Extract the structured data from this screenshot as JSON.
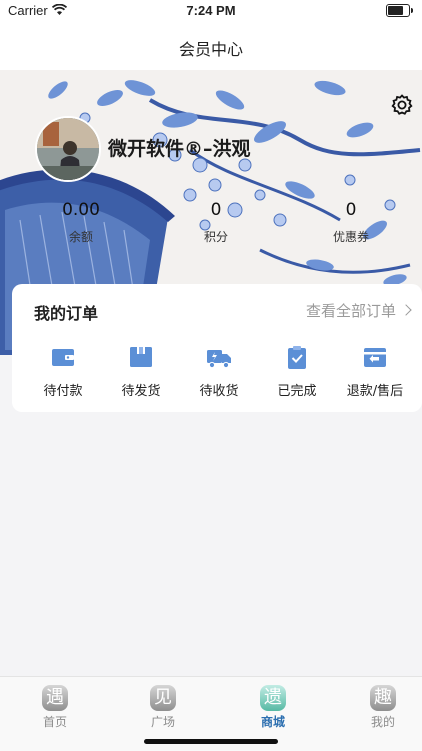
{
  "status_bar": {
    "carrier": "Carrier",
    "time": "7:24 PM"
  },
  "nav": {
    "title": "会员中心"
  },
  "profile": {
    "username": "微开软件®–洪观",
    "stats": [
      {
        "value": "0.00",
        "label": "余额"
      },
      {
        "value": "0",
        "label": "积分"
      },
      {
        "value": "0",
        "label": "优惠券"
      }
    ]
  },
  "orders": {
    "title": "我的订单",
    "view_all": "查看全部订单",
    "items": [
      {
        "label": "待付款",
        "icon": "wallet-icon"
      },
      {
        "label": "待发货",
        "icon": "box-icon"
      },
      {
        "label": "待收货",
        "icon": "truck-icon"
      },
      {
        "label": "已完成",
        "icon": "clipboard-check-icon"
      },
      {
        "label": "退款/售后",
        "icon": "refund-icon"
      }
    ]
  },
  "tabbar": {
    "items": [
      {
        "glyph": "遇",
        "label": "首页"
      },
      {
        "glyph": "见",
        "label": "广场"
      },
      {
        "glyph": "遗",
        "label": "商城",
        "active": true
      },
      {
        "glyph": "趣",
        "label": "我的"
      }
    ]
  },
  "colors": {
    "accent": "#2c6fb0",
    "icon_blue": "#5b8fd6",
    "tab_active": "#57b9a4"
  }
}
